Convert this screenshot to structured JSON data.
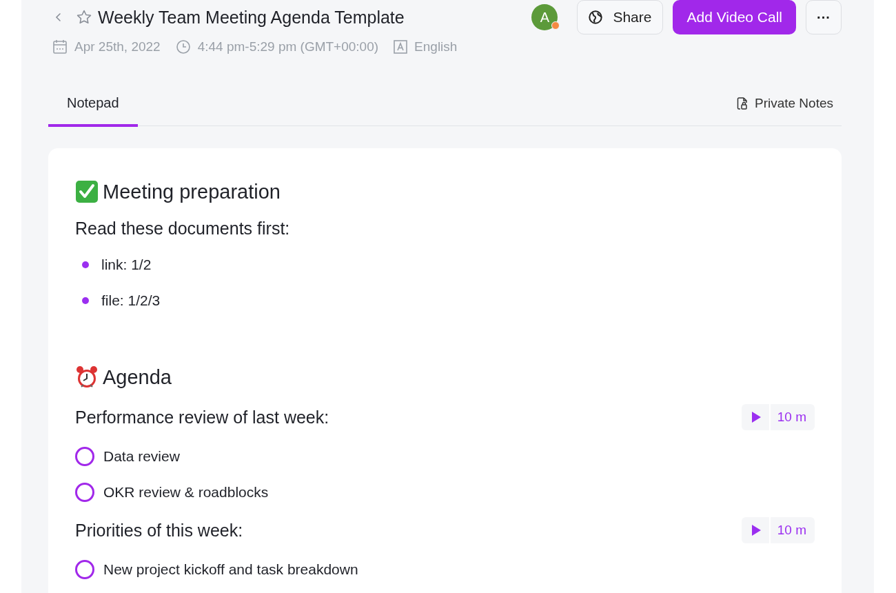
{
  "header": {
    "title": "Weekly Team Meeting Agenda Template",
    "starred": false,
    "avatar": {
      "initial": "A",
      "color": "#5c9a3a",
      "online": true
    },
    "buttons": [
      {
        "kind": "share",
        "label": "Share"
      },
      {
        "kind": "primary",
        "label": "Add Video Call"
      },
      {
        "kind": "more",
        "label": "···"
      }
    ],
    "meta": [
      {
        "kind": "date",
        "text": "Apr 25th, 2022"
      },
      {
        "kind": "time",
        "text": "4:44 pm-5:29 pm (GMT+00:00)"
      },
      {
        "kind": "language",
        "text": "English"
      }
    ]
  },
  "tabs": [
    {
      "label": "Notepad",
      "selected": true,
      "kind": "plain"
    },
    {
      "label": "Private Notes",
      "selected": false,
      "kind": "lock"
    }
  ],
  "sections": [
    {
      "kind": "check",
      "title": "Meeting preparation",
      "blocks": [
        {
          "kind": "subheading",
          "text": "Read these documents first:"
        },
        {
          "kind": "bullet",
          "text": "link: 1/2"
        },
        {
          "kind": "bullet",
          "text": "file: 1/2/3"
        }
      ]
    },
    {
      "kind": "clock",
      "title": "Agenda",
      "blocks": [
        {
          "kind": "subheading",
          "text": "Performance review of last week:",
          "timer": "10 m"
        },
        {
          "kind": "todo",
          "text": "Data review",
          "checked": false
        },
        {
          "kind": "todo",
          "text": "OKR review & roadblocks",
          "checked": false
        },
        {
          "kind": "subheading",
          "text": "Priorities of this week:",
          "timer": "10 m"
        },
        {
          "kind": "todo",
          "text": "New project kickoff and task breakdown",
          "checked": false
        }
      ]
    }
  ]
}
